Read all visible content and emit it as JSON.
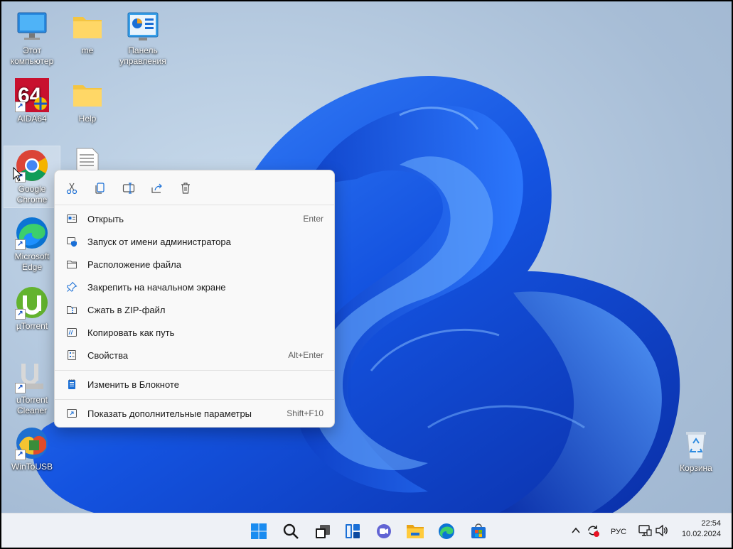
{
  "desktop": {
    "icons": [
      {
        "label": "Этот\nкомпьютер"
      },
      {
        "label": "me"
      },
      {
        "label": "Панель\nуправления"
      },
      {
        "label": "AIDA64"
      },
      {
        "label": "Help"
      },
      {
        "label": "Google\nChrome"
      },
      {
        "label": "Microsoft\nEdge"
      },
      {
        "label": "µTorrent"
      },
      {
        "label": "uTorrent\nCleaner"
      },
      {
        "label": "WinToUSB"
      },
      {
        "label": "Корзина"
      }
    ]
  },
  "context_menu": {
    "toolbar": [
      {
        "icon": "cut-icon"
      },
      {
        "icon": "copy-icon"
      },
      {
        "icon": "rename-icon"
      },
      {
        "icon": "share-icon"
      },
      {
        "icon": "delete-icon"
      }
    ],
    "items": [
      {
        "label": "Открыть",
        "shortcut": "Enter",
        "icon": "open-icon"
      },
      {
        "label": "Запуск от имени администратора",
        "shortcut": "",
        "icon": "shield-icon"
      },
      {
        "label": "Расположение файла",
        "shortcut": "",
        "icon": "folder-icon"
      },
      {
        "label": "Закрепить на начальном экране",
        "shortcut": "",
        "icon": "pin-icon"
      },
      {
        "label": "Сжать в ZIP-файл",
        "shortcut": "",
        "icon": "zip-icon"
      },
      {
        "label": "Копировать как путь",
        "shortcut": "",
        "icon": "copy-path-icon"
      },
      {
        "label": "Свойства",
        "shortcut": "Alt+Enter",
        "icon": "properties-icon"
      },
      {
        "label": "Изменить в Блокноте",
        "shortcut": "",
        "icon": "notepad-icon"
      },
      {
        "label": "Показать дополнительные параметры",
        "shortcut": "Shift+F10",
        "icon": "more-options-icon"
      }
    ]
  },
  "taskbar": {
    "apps": [
      "start-icon",
      "search-icon",
      "task-view-icon",
      "widgets-icon",
      "chat-icon",
      "file-explorer-icon",
      "edge-icon",
      "store-icon"
    ],
    "tray": {
      "language": "РУС",
      "time": "22:54",
      "date": "10.02.2024"
    }
  },
  "colors": {
    "accent": "#1a6fd6",
    "menu_bg": "#f9f9f9",
    "taskbar_bg": "#eef1f6"
  }
}
